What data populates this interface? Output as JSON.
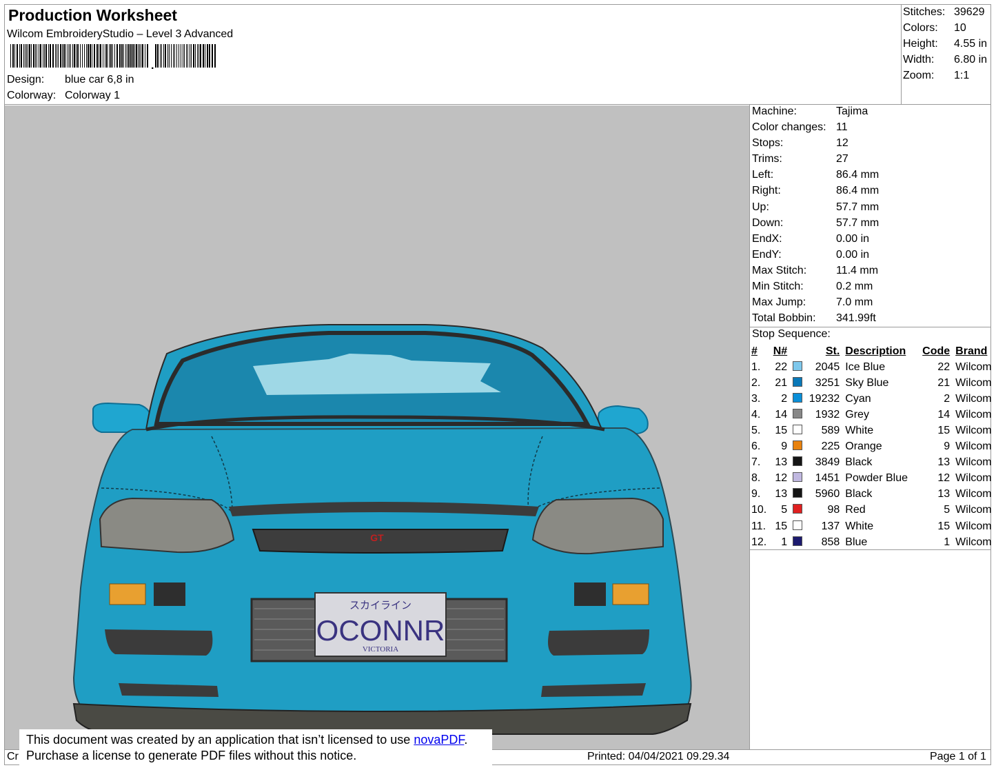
{
  "header": {
    "title": "Production Worksheet",
    "software": "Wilcom EmbroideryStudio – Level 3 Advanced",
    "design_label": "Design:",
    "design_value": "blue car 6,8 in",
    "colorway_label": "Colorway:",
    "colorway_value": "Colorway 1"
  },
  "summary": [
    {
      "label": "Stitches:",
      "value": "39629"
    },
    {
      "label": "Colors:",
      "value": "10"
    },
    {
      "label": "Height:",
      "value": "4.55 in"
    },
    {
      "label": "Width:",
      "value": "6.80 in"
    },
    {
      "label": "Zoom:",
      "value": "1:1"
    }
  ],
  "machine_info": [
    {
      "label": "Machine:",
      "value": "Tajima"
    },
    {
      "label": "Color changes:",
      "value": "11"
    },
    {
      "label": "Stops:",
      "value": "12"
    },
    {
      "label": "Trims:",
      "value": "27"
    },
    {
      "label": "Left:",
      "value": "86.4 mm"
    },
    {
      "label": "Right:",
      "value": "86.4 mm"
    },
    {
      "label": "Up:",
      "value": "57.7 mm"
    },
    {
      "label": "Down:",
      "value": "57.7 mm"
    },
    {
      "label": "EndX:",
      "value": "0.00 in"
    },
    {
      "label": "EndY:",
      "value": "0.00 in"
    },
    {
      "label": "Max Stitch:",
      "value": "11.4 mm"
    },
    {
      "label": "Min Stitch:",
      "value": "0.2 mm"
    },
    {
      "label": "Max Jump:",
      "value": "7.0 mm"
    },
    {
      "label": "Total Bobbin:",
      "value": "341.99ft"
    }
  ],
  "stop_sequence": {
    "title": "Stop Sequence:",
    "headers": {
      "idx": "#",
      "n": "N#",
      "st": "St.",
      "desc": "Description",
      "code": "Code",
      "brand": "Brand"
    },
    "rows": [
      {
        "idx": "1.",
        "n": "22",
        "color": "#7ec8ec",
        "st": "2045",
        "desc": "Ice Blue",
        "code": "22",
        "brand": "Wilcom"
      },
      {
        "idx": "2.",
        "n": "21",
        "color": "#0a78b8",
        "st": "3251",
        "desc": "Sky Blue",
        "code": "21",
        "brand": "Wilcom"
      },
      {
        "idx": "3.",
        "n": "2",
        "color": "#0a8fd8",
        "st": "19232",
        "desc": "Cyan",
        "code": "2",
        "brand": "Wilcom"
      },
      {
        "idx": "4.",
        "n": "14",
        "color": "#888888",
        "st": "1932",
        "desc": "Grey",
        "code": "14",
        "brand": "Wilcom"
      },
      {
        "idx": "5.",
        "n": "15",
        "color": "#ffffff",
        "st": "589",
        "desc": "White",
        "code": "15",
        "brand": "Wilcom"
      },
      {
        "idx": "6.",
        "n": "9",
        "color": "#e8820e",
        "st": "225",
        "desc": "Orange",
        "code": "9",
        "brand": "Wilcom"
      },
      {
        "idx": "7.",
        "n": "13",
        "color": "#151515",
        "st": "3849",
        "desc": "Black",
        "code": "13",
        "brand": "Wilcom"
      },
      {
        "idx": "8.",
        "n": "12",
        "color": "#c0b8e0",
        "st": "1451",
        "desc": "Powder Blue",
        "code": "12",
        "brand": "Wilcom"
      },
      {
        "idx": "9.",
        "n": "13",
        "color": "#151515",
        "st": "5960",
        "desc": "Black",
        "code": "13",
        "brand": "Wilcom"
      },
      {
        "idx": "10.",
        "n": "5",
        "color": "#e02020",
        "st": "98",
        "desc": "Red",
        "code": "5",
        "brand": "Wilcom"
      },
      {
        "idx": "11.",
        "n": "15",
        "color": "#ffffff",
        "st": "137",
        "desc": "White",
        "code": "15",
        "brand": "Wilcom"
      },
      {
        "idx": "12.",
        "n": "1",
        "color": "#1c1a6e",
        "st": "858",
        "desc": "Blue",
        "code": "1",
        "brand": "Wilcom"
      }
    ]
  },
  "preview": {
    "plate_text": "OCONNR",
    "plate_sub": "VICTORIA",
    "plate_top": "スカイライン",
    "badge": "GT",
    "colors": {
      "background": "#c0c0c0",
      "body": "#1f9ec4",
      "windshield": "#1b87ad",
      "glare": "#9fd8e6",
      "trim": "#3b3b3b",
      "lamp": "#8a8a8a",
      "indicator": "#e8a030",
      "badge": "#c02020"
    }
  },
  "footer": {
    "notice_line1": "This document was created by an application that isn’t licensed to use ",
    "notice_link": "novaPDF",
    "notice_period": ".",
    "notice_line2": "Purchase a license to generate PDF files without this notice.",
    "cr": "Cr",
    "printed": "Printed: 04/04/2021 09.29.34",
    "page": "Page 1 of 1"
  }
}
